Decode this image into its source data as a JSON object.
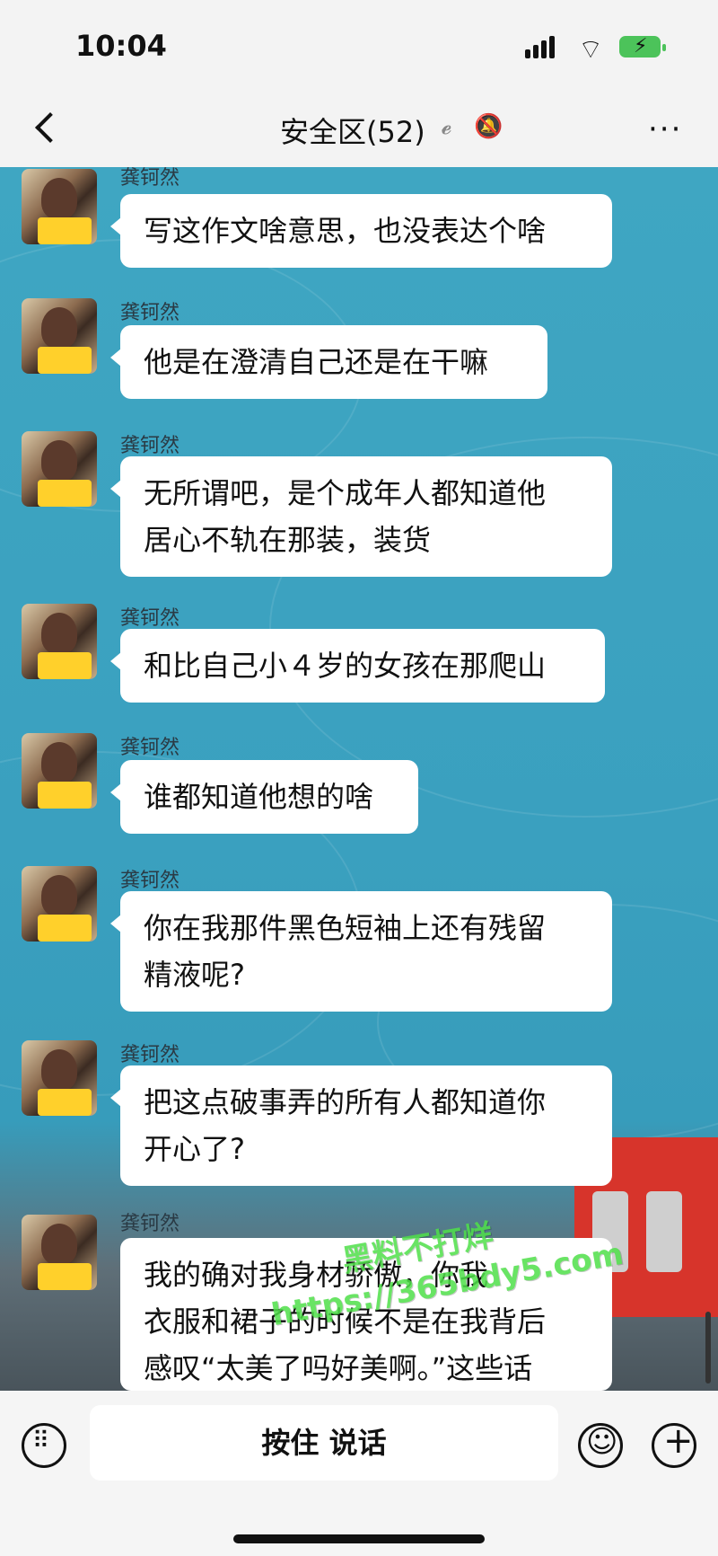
{
  "status_bar": {
    "time": "10:04"
  },
  "nav": {
    "title": "安全区(52)",
    "more": "···"
  },
  "messages": [
    {
      "sender": "龚钶然",
      "text": "写这作文啥意思，也没表达个啥"
    },
    {
      "sender": "龚钶然",
      "text": "他是在澄清自己还是在干嘛"
    },
    {
      "sender": "龚钶然",
      "text": "无所谓吧，是个成年人都知道他\n居心不轨在那装，装货"
    },
    {
      "sender": "龚钶然",
      "text": "和比自己小４岁的女孩在那爬山"
    },
    {
      "sender": "龚钶然",
      "text": "谁都知道他想的啥"
    },
    {
      "sender": "龚钶然",
      "text": "你在我那件黑色短袖上还有残留\n精液呢?"
    },
    {
      "sender": "龚钶然",
      "text": "把这点破事弄的所有人都知道你\n开心了?"
    },
    {
      "sender": "龚钶然",
      "text": "我的确对我身材骄傲，你我\n衣服和裙子的时候不是在我背后\n感叹“太美了吗好美啊。”这些话\n你忘了不说"
    }
  ],
  "watermark": {
    "line1": "黑料不打烊",
    "line2": "https://365bdy5.com"
  },
  "input_bar": {
    "talk_label": "按住 说话"
  },
  "colors": {
    "wallpaper": "#3fa6c2",
    "bubble": "#ffffff",
    "bar_bg": "#f3f3f3",
    "watermark": "#4fe04a"
  },
  "icons": [
    "back-chevron-icon",
    "ear-icon",
    "mute-bell-icon",
    "more-icon",
    "keyboard-icon",
    "emoji-icon",
    "plus-icon"
  ]
}
